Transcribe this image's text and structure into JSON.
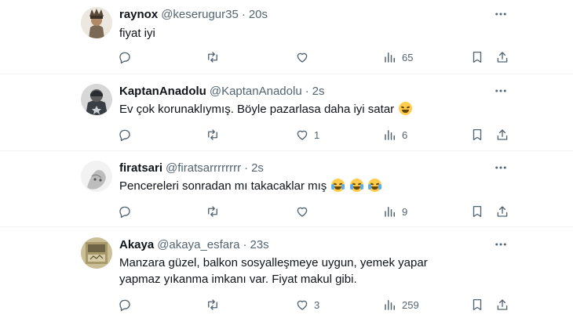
{
  "tweets": [
    {
      "name": "raynox",
      "handle": "@keserugur35",
      "dot": "·",
      "time": "20s",
      "text": "fiyat iyi",
      "replies": "",
      "retweets": "",
      "likes": "",
      "views": "65"
    },
    {
      "name": "KaptanAnadolu",
      "handle": "@KaptanAnadolu",
      "dot": "·",
      "time": "2s",
      "text": "Ev çok korunaklıymış. Böyle pazarlasa daha iyi satar",
      "emoji": "grinning-sweat-emoji",
      "replies": "",
      "retweets": "",
      "likes": "1",
      "views": "6"
    },
    {
      "name": "firatsari",
      "handle": "@firatsarrrrrrrr",
      "dot": "·",
      "time": "2s",
      "text": "Pencereleri sonradan mı takacaklar mış",
      "emoji": "tears-of-joy-emoji x3",
      "replies": "",
      "retweets": "",
      "likes": "",
      "views": "9"
    },
    {
      "name": "Akaya",
      "handle": "@akaya_esfara",
      "dot": "·",
      "time": "23s",
      "text": "Manzara güzel, balkon sosyalleşmeye uygun, yemek yapar yapmaz yıkanma imkanı var. Fiyat makul gibi.",
      "replies": "",
      "retweets": "",
      "likes": "3",
      "views": "259"
    }
  ],
  "colors": {
    "text": "#0f1419",
    "secondary": "#536471",
    "divider": "#eff3f4",
    "emoji": "#ffcc4d"
  },
  "icons": [
    "reply-icon",
    "retweet-icon",
    "like-icon",
    "views-icon",
    "bookmark-icon",
    "share-icon",
    "more-icon"
  ]
}
